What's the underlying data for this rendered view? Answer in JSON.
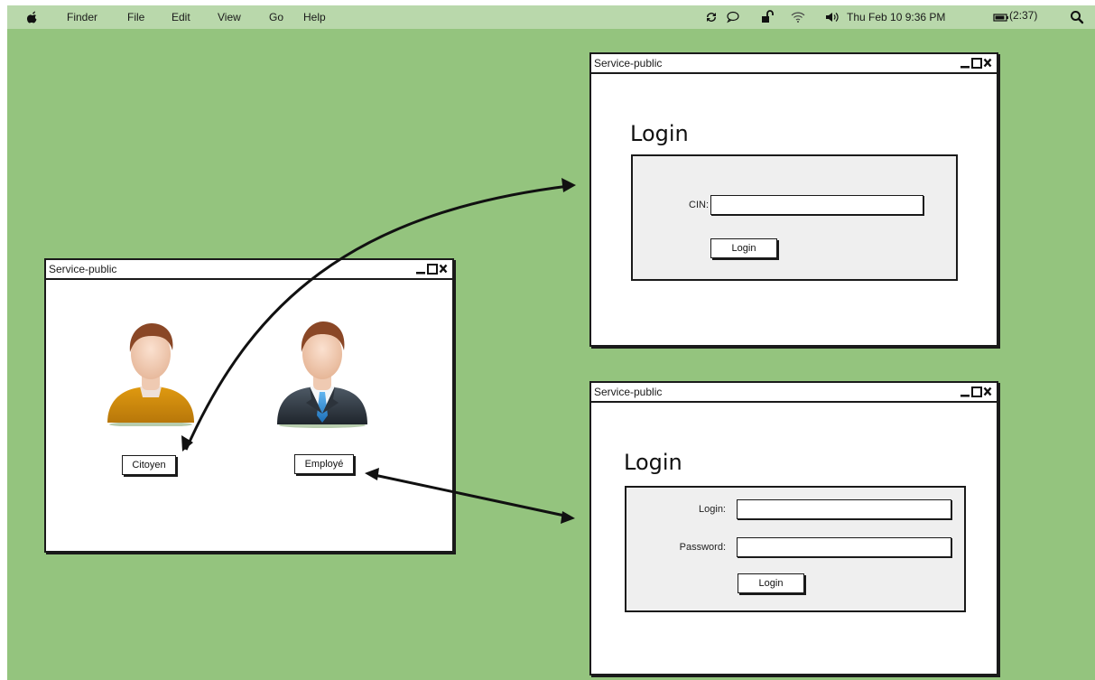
{
  "menubar": {
    "items": [
      "Finder",
      "File",
      "Edit",
      "View",
      "Go",
      "Help"
    ],
    "clock": "Thu Feb 10  9:36 PM",
    "battery": "(2:37)"
  },
  "windows": {
    "chooser": {
      "title": "Service-public",
      "citoyen_label": "Citoyen",
      "employe_label": "Employé"
    },
    "citizen_login": {
      "title": "Service-public",
      "heading": "Login",
      "cin_label": "CIN:",
      "cin_value": "",
      "button_label": "Login"
    },
    "employee_login": {
      "title": "Service-public",
      "heading": "Login",
      "login_label": "Login:",
      "login_value": "",
      "password_label": "Password:",
      "password_value": "",
      "button_label": "Login"
    }
  },
  "colors": {
    "desktop": "#94c47e",
    "menubar": "#b9d8ab",
    "panel": "#efefef",
    "outline": "#1a1a1a"
  }
}
